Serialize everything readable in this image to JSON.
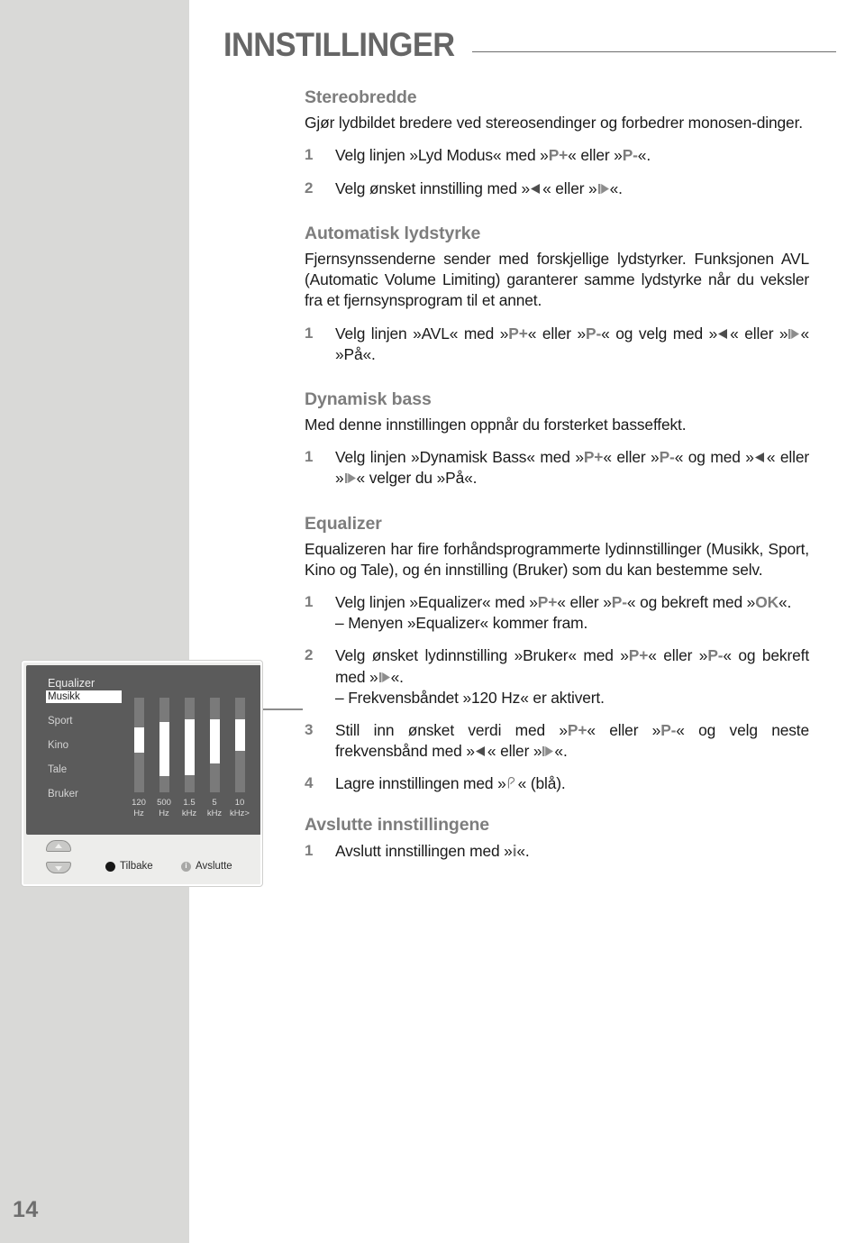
{
  "page": {
    "title": "INNSTILLINGER",
    "number": "14"
  },
  "sections": [
    {
      "heading": "Stereobredde",
      "intro": "Gjør lydbildet bredere ved stereosendinger og forbedrer monosendinger.",
      "steps": [
        {
          "num": "1",
          "text": "Velg linjen »Lyd Modus« med »P+« eller »P-«."
        },
        {
          "num": "2",
          "text": "Velg ønsket innstilling med »◀« eller »▶«."
        }
      ]
    },
    {
      "heading": "Automatisk lydstyrke",
      "intro": "Fjernsynssenderne sender med forskjellige lydstyrker. Funksjonen AVL (Automatic Volume Limiting) garanterer samme lydstyrke når du veksler fra et fjernsynsprogram til et annet.",
      "steps": [
        {
          "num": "1",
          "text": "Velg linjen »AVL« med »P+« eller »P-« og velg med »◀« eller »▶« »På«."
        }
      ]
    },
    {
      "heading": "Dynamisk bass",
      "intro": "Med denne innstillingen oppnår du forsterket basseffekt.",
      "steps": [
        {
          "num": "1",
          "text": "Velg linjen »Dynamisk Bass« med »P+« eller »P-« og med »◀« eller »▶« velger du »På«."
        }
      ]
    },
    {
      "heading": "Equalizer",
      "intro": "Equalizeren har fire forhåndsprogrammerte lydinnstillinger (Musikk, Sport, Kino og Tale), og én innstilling (Bruker) som du kan bestemme selv.",
      "steps": [
        {
          "num": "1",
          "text": "Velg linjen »Equalizer« med »P+« eller »P-« og bekreft med »OK«.",
          "sub": "– Menyen »Equalizer« kommer fram."
        },
        {
          "num": "2",
          "text": "Velg ønsket lydinnstilling »Bruker« med »P+« eller »P-« og bekreft med »▶«.",
          "sub": "– Frekvensbåndet »120 Hz« er aktivert."
        },
        {
          "num": "3",
          "text": "Still inn ønsket verdi med »P+« eller »P-« og velg neste frekvensbånd med »◀« eller »▶«."
        },
        {
          "num": "4",
          "text": "Lagre innstillingen med »♪« (blå)."
        }
      ]
    },
    {
      "heading": "Avslutte innstillingene",
      "steps": [
        {
          "num": "1",
          "text": "Avslutt innstillingen med »i«."
        }
      ]
    }
  ],
  "text_fragments": {
    "s1_intro": "Gjør lydbildet bredere ved stereosendinger og forbedrer monosen-dinger.",
    "s1_step1_a": "Velg linjen »Lyd Modus« med »",
    "s1_step1_p_plus": "P+",
    "s1_step1_b": "« eller »",
    "s1_step1_p_minus": "P-",
    "s1_step1_c": "«.",
    "s1_step2_a": "Velg ønsket innstilling med »",
    "s1_step2_b": "« eller »",
    "s1_step2_c": "«.",
    "s2_intro": "Fjernsynssenderne sender med forskjellige lydstyrker. Funksjonen AVL (Automatic Volume Limiting) garanterer samme lydstyrke når du veksler fra et fjernsynsprogram til et annet.",
    "s2_step1_a": "Velg linjen »AVL« med »",
    "s2_step1_b": "« eller »",
    "s2_step1_c": "« og velg med »",
    "s2_step1_d": "« eller »",
    "s2_step1_e": "« »På«.",
    "s3_intro": "Med denne innstillingen oppnår du forsterket basseffekt.",
    "s3_step1_a": "Velg linjen »Dynamisk Bass« med »",
    "s3_step1_b": "« eller »",
    "s3_step1_c": "« og med »",
    "s3_step1_d": "« eller »",
    "s3_step1_e": "« velger du »På«.",
    "s4_intro": "Equalizeren har fire forhåndsprogrammerte lydinnstillinger (Musikk, Sport, Kino og Tale), og én innstilling (Bruker) som du kan bestemme selv.",
    "s4_step1_a": "Velg linjen »Equalizer« med »",
    "s4_step1_b": "« eller »",
    "s4_step1_c": "« og bekreft med »",
    "s4_step1_ok": "OK",
    "s4_step1_d": "«.",
    "s4_step1_sub": "– Menyen »Equalizer« kommer fram.",
    "s4_step2_a": "Velg ønsket lydinnstilling »Bruker« med »",
    "s4_step2_b": "« eller »",
    "s4_step2_c": "« og bekreft med »",
    "s4_step2_d": "«.",
    "s4_step2_sub": "– Frekvensbåndet »120 Hz« er aktivert.",
    "s4_step3_a": "Still inn ønsket verdi med »",
    "s4_step3_b": "« eller »",
    "s4_step3_c": "« og velg neste frekvensbånd med »",
    "s4_step3_d": "« eller »",
    "s4_step3_e": "«.",
    "s4_step4_a": "Lagre innstillingen med »",
    "s4_step4_b": "« (blå).",
    "s5_step1_a": "Avslutt innstillingen med »",
    "s5_step1_i": "i",
    "s5_step1_b": "«."
  },
  "equalizer_screenshot": {
    "title": "Equalizer",
    "items": [
      {
        "label": "Musikk",
        "selected": true
      },
      {
        "label": "Sport",
        "selected": false
      },
      {
        "label": "Kino",
        "selected": false
      },
      {
        "label": "Tale",
        "selected": false
      },
      {
        "label": "Bruker",
        "selected": false
      }
    ],
    "bands": [
      {
        "label_top": "120",
        "label_bottom": "Hz",
        "fill_top_pct": 31,
        "fill_height_pct": 27
      },
      {
        "label_top": "500",
        "label_bottom": "Hz",
        "fill_top_pct": 26,
        "fill_height_pct": 57
      },
      {
        "label_top": "1.5",
        "label_bottom": "kHz",
        "fill_top_pct": 23,
        "fill_height_pct": 59
      },
      {
        "label_top": "5",
        "label_bottom": "kHz",
        "fill_top_pct": 23,
        "fill_height_pct": 47
      },
      {
        "label_top": "10",
        "label_bottom": "kHz>",
        "fill_top_pct": 23,
        "fill_height_pct": 33
      }
    ],
    "footer": {
      "back_label": "Tilbake",
      "exit_label": "Avslutte",
      "info_glyph": "i"
    }
  },
  "colors": {
    "band": "#d9d9d7",
    "heading": "#7d7d7d",
    "title": "#666666",
    "body": "#1a1a1a",
    "screen": "#5b5b5b",
    "bar_track": "#7a7a7a",
    "bar_fill": "#ffffff"
  }
}
